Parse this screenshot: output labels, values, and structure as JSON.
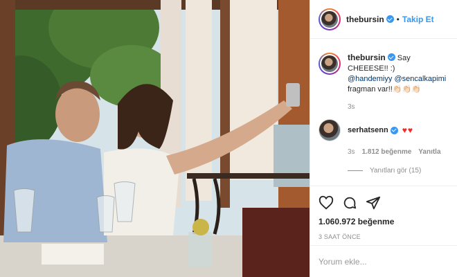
{
  "header": {
    "username": "thebursin",
    "separator": "•",
    "follow_label": "Takip Et"
  },
  "caption": {
    "username": "thebursin",
    "text": "Say CHEEESE!! :)",
    "mention1": "@handemiyy",
    "mention2": "@sencalkapimi",
    "trailing": "fragman var!!👏🏻👏🏻👏🏻",
    "time": "3s"
  },
  "reply": {
    "username": "serhatsenn",
    "hearts": "♥♥",
    "time": "3s",
    "likes": "1.812 beğenme",
    "reply_label": "Yanıtla",
    "view_replies": "Yanıtları gör (15)"
  },
  "actions": {
    "icons": [
      "heart-icon",
      "comment-icon",
      "share-icon"
    ],
    "likes": "1.060.972 beğenme",
    "posted_ago": "3 SAAT ÖNCE"
  },
  "add_comment": {
    "placeholder": "Yorum ekle..."
  },
  "colors": {
    "accent": "#3897f0",
    "secondary_text": "#8e8e8e",
    "heart": "#ed2b2b"
  }
}
